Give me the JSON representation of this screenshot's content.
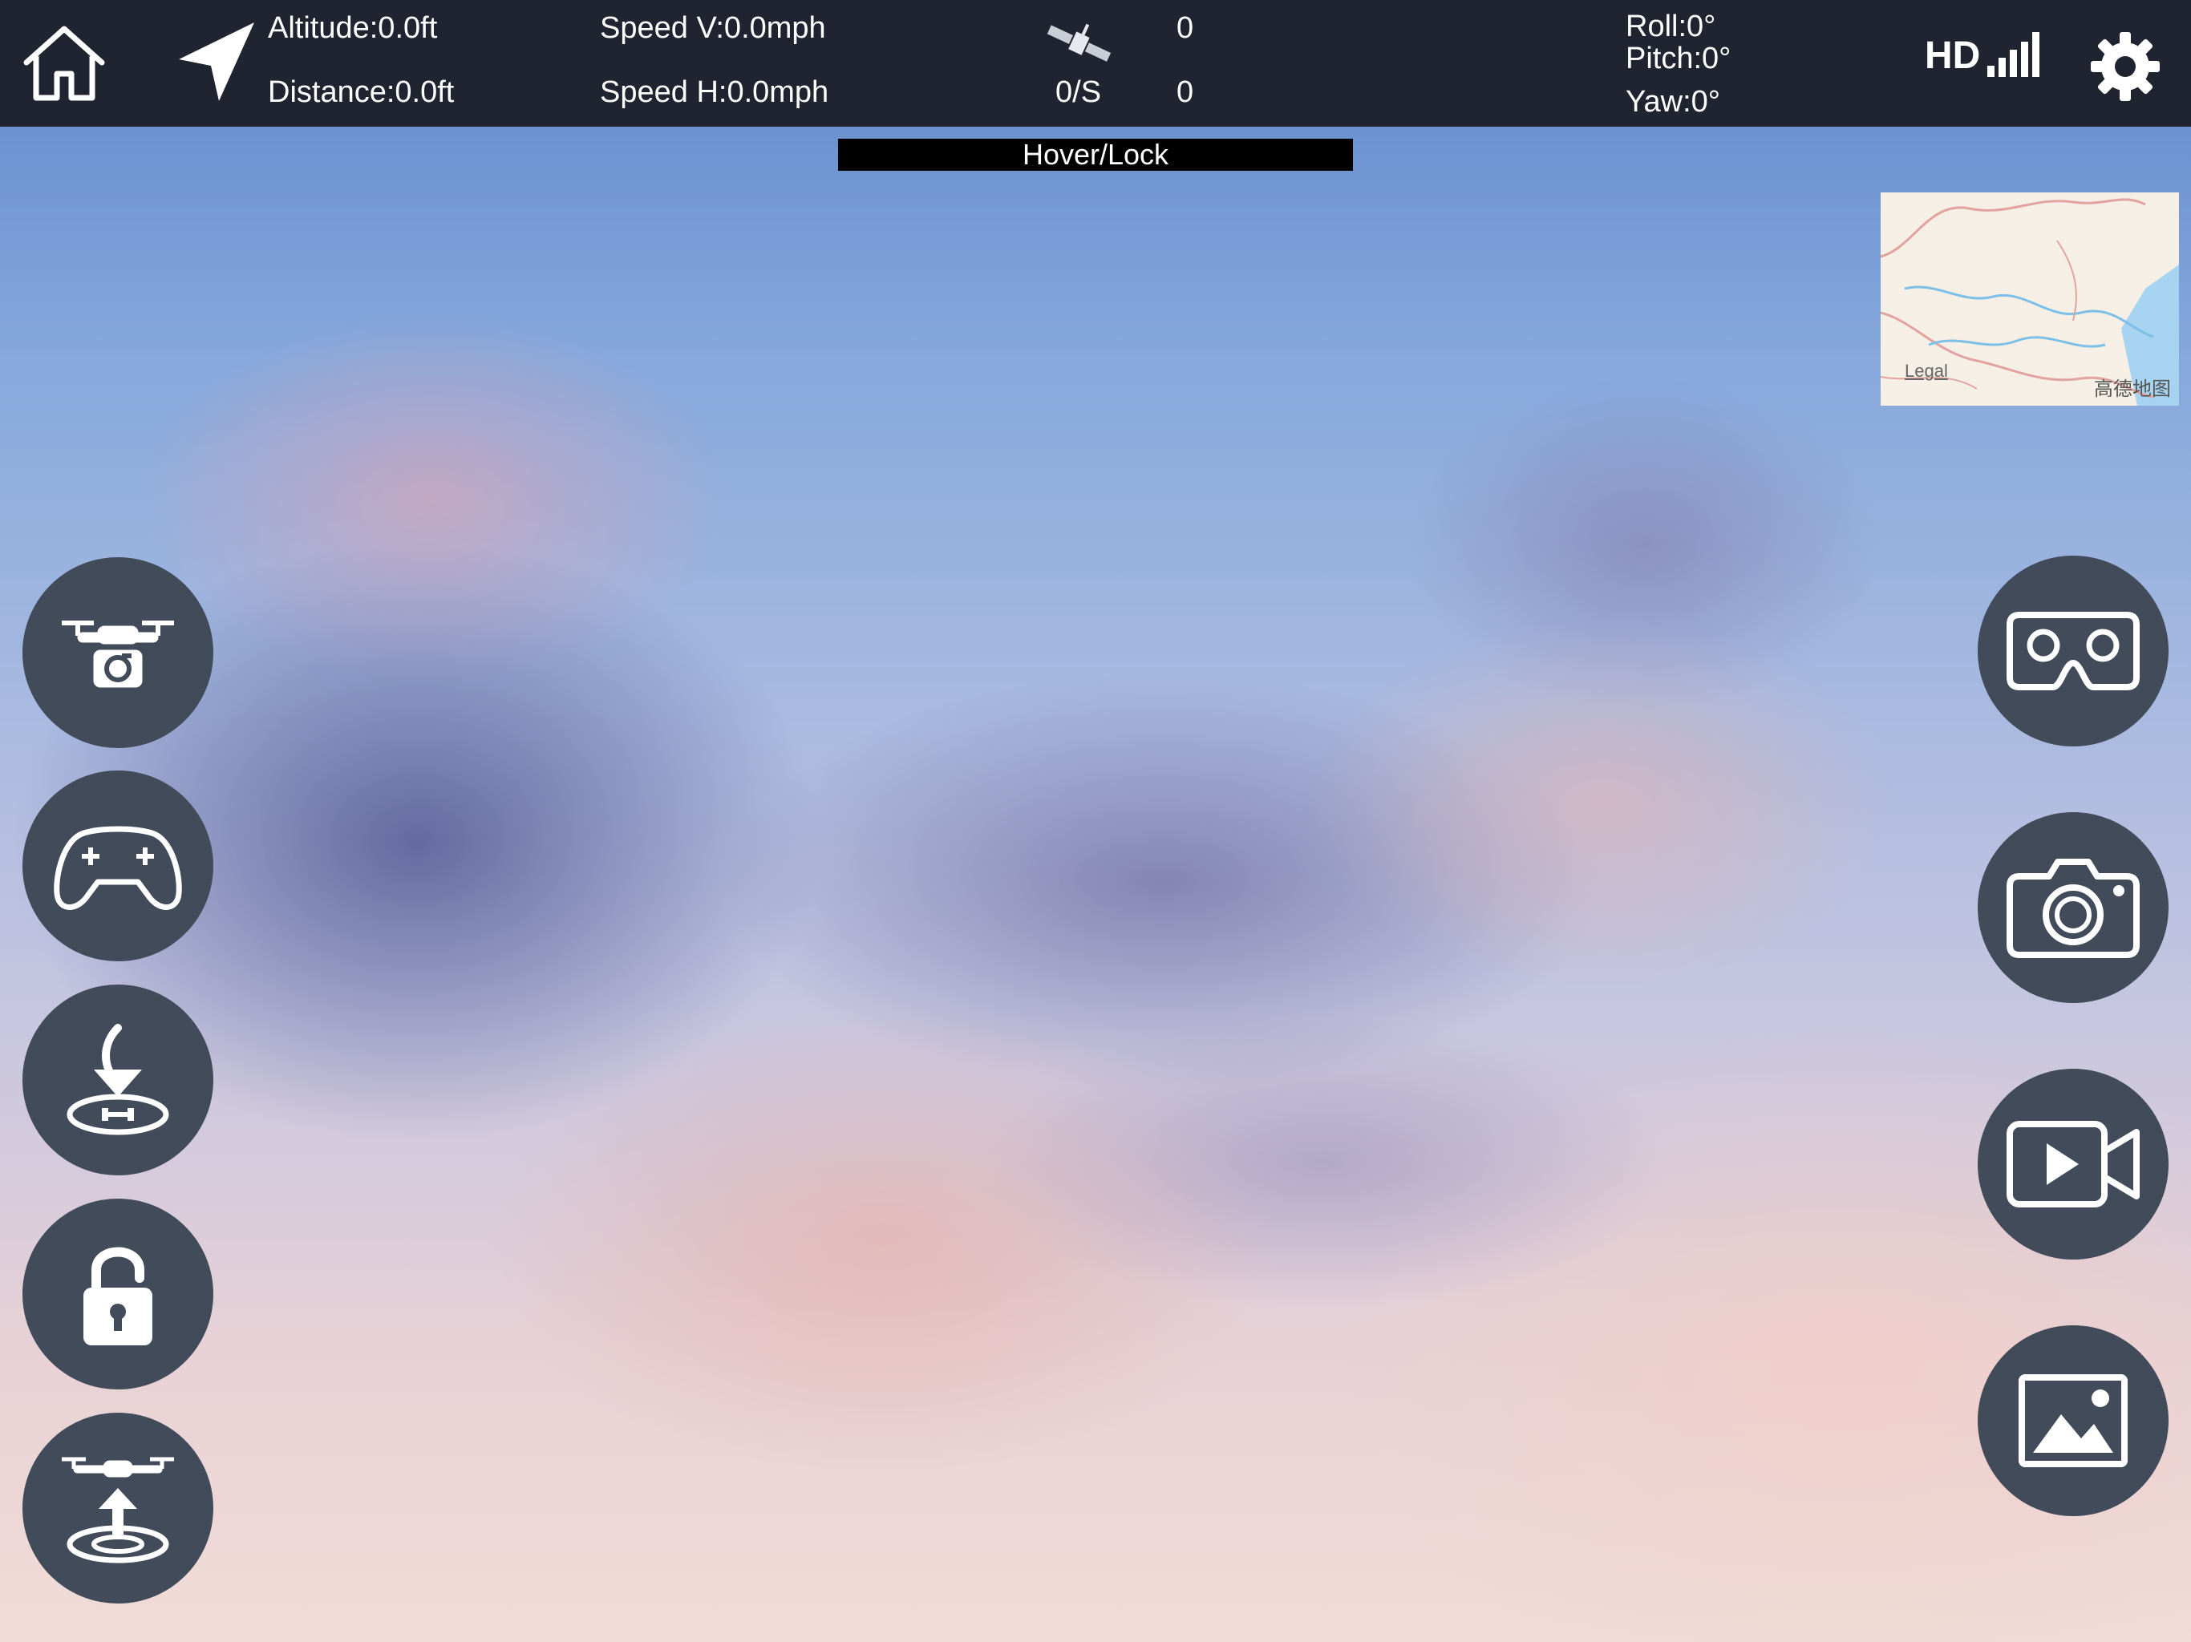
{
  "telemetry": {
    "altitude": "Altitude:0.0ft",
    "distance": "Distance:0.0ft",
    "speed_v": "Speed V:0.0mph",
    "speed_h": "Speed H:0.0mph",
    "satellite_count": "0",
    "rate": "0/S",
    "rate_value": "0",
    "roll": "Roll:0°",
    "pitch": "Pitch:0°",
    "yaw": "Yaw:0°",
    "signal_label": "HD"
  },
  "flight_mode": "Hover/Lock",
  "minimap": {
    "legal": "Legal",
    "brand": "高德地图"
  },
  "icons": {
    "home": "home-icon",
    "plane": "navigation-arrow-icon",
    "satellite": "satellite-icon",
    "signal": "signal-strength-icon",
    "settings": "gear-icon",
    "drone_camera": "drone-camera-icon",
    "gamepad": "gamepad-icon",
    "land": "landing-icon",
    "unlock": "unlock-icon",
    "takeoff": "takeoff-icon",
    "vr": "vr-goggles-icon",
    "camera": "camera-icon",
    "video": "video-icon",
    "gallery": "gallery-icon"
  },
  "colors": {
    "topbar": "#1f2430",
    "button_bg": "#424b5a",
    "icon": "#ffffff"
  }
}
